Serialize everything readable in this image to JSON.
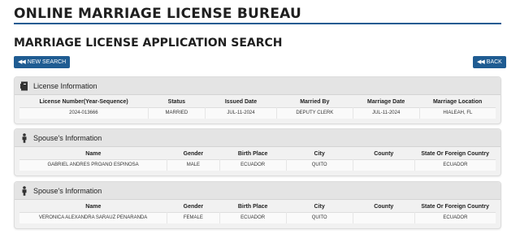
{
  "site": {
    "title": "ONLINE MARRIAGE LICENSE BUREAU"
  },
  "page": {
    "title": "MARRIAGE LICENSE APPLICATION SEARCH"
  },
  "buttons": {
    "new_search": "NEW SEARCH",
    "back": "BACK"
  },
  "license": {
    "heading": "License Information",
    "columns": [
      "License Number(Year-Sequence)",
      "Status",
      "Issued Date",
      "Married By",
      "Marriage Date",
      "Marriage Location"
    ],
    "row": [
      "2024-013666",
      "MARRIED",
      "JUL-11-2024",
      "DEPUTY CLERK",
      "JUL-11-2024",
      "HIALEAH, FL"
    ]
  },
  "spouse1": {
    "heading": "Spouse's Information",
    "columns": [
      "Name",
      "Gender",
      "Birth Place",
      "City",
      "County",
      "State Or Foreign Country"
    ],
    "row": [
      "GABRIEL ANDRES PROANO ESPINOSA",
      "MALE",
      "ECUADOR",
      "QUITO",
      "",
      "ECUADOR"
    ]
  },
  "spouse2": {
    "heading": "Spouse's Information",
    "columns": [
      "Name",
      "Gender",
      "Birth Place",
      "City",
      "County",
      "State Or Foreign Country"
    ],
    "row": [
      "VERONICA ALEXANDRA SARAUZ PENARANDA",
      "FEMALE",
      "ECUADOR",
      "QUITO",
      "",
      "ECUADOR"
    ]
  },
  "colors": {
    "accent": "#1f5c92",
    "panel_bg": "#f1f1f1"
  }
}
